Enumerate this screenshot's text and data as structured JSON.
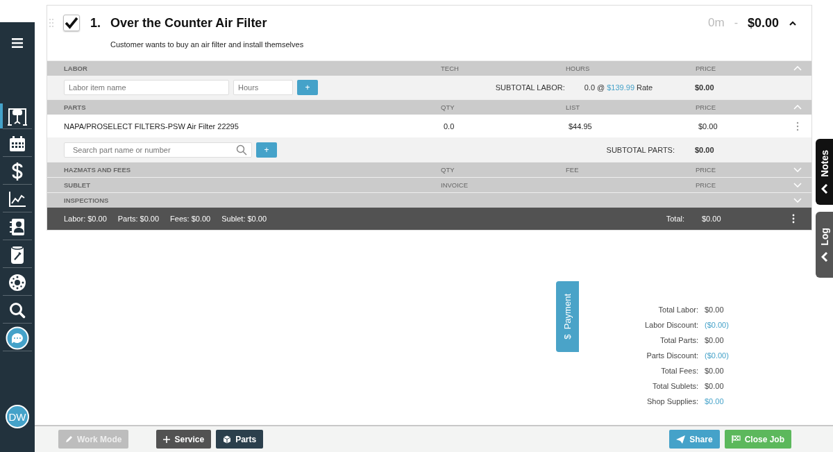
{
  "sidebar": {
    "items": [
      {
        "kind": "menu",
        "selected": false
      },
      {
        "kind": "lift",
        "selected": true
      },
      {
        "kind": "calendar",
        "selected": false
      },
      {
        "kind": "dollar",
        "selected": false
      },
      {
        "kind": "chart",
        "selected": false
      },
      {
        "kind": "contact",
        "selected": false
      },
      {
        "kind": "oil",
        "selected": false
      },
      {
        "kind": "wheel",
        "selected": false
      },
      {
        "kind": "search",
        "selected": false
      },
      {
        "kind": "chat",
        "selected": false
      }
    ],
    "avatar": "DW"
  },
  "job": {
    "checked": true,
    "number": "1.",
    "title": "Over the Counter Air Filter",
    "description": "Customer wants to buy an air filter and install themselves",
    "duration": "0m",
    "separator": "-",
    "price": "$0.00",
    "expanded": true
  },
  "labor": {
    "title": "LABOR",
    "column_1": "TECH",
    "column_2": "HOURS",
    "column_3": "PRICE",
    "expanded": true,
    "name_placeholder": "Labor item name",
    "hours_placeholder": "Hours",
    "add": "+",
    "subtotal_label": "SUBTOTAL LABOR:",
    "subtotal_hours": "0.0 @",
    "rate": "$139.99",
    "rate_suffix": "Rate",
    "subtotal": "$0.00"
  },
  "parts": {
    "title": "PARTS",
    "column_1": "QTY",
    "column_2": "LIST",
    "column_3": "PRICE",
    "expanded": true,
    "rows": [
      {
        "name": "NAPA/PROSELECT FILTERS-PSW Air Filter 22295",
        "qty": "0.0",
        "list": "$44.95",
        "price": "$0.00"
      }
    ],
    "search_placeholder": "Search part name or number",
    "add": "+",
    "subtotal_label": "SUBTOTAL PARTS:",
    "subtotal": "$0.00"
  },
  "sections": [
    {
      "title": "HAZMATS AND FEES",
      "column_1": "QTY",
      "column_2": "FEE",
      "column_3": "PRICE",
      "expanded": false
    },
    {
      "title": "SUBLET",
      "column_1": "INVOICE",
      "column_3": "PRICE",
      "expanded": false
    },
    {
      "title": "INSPECTIONS",
      "expanded": false
    }
  ],
  "summary": {
    "items": [
      "Labor: $0.00",
      "Parts: $0.00",
      "Fees: $0.00",
      "Sublet: $0.00"
    ],
    "total_label": "Total:",
    "total": "$0.00"
  },
  "payment_tab": {
    "icon": "$",
    "label": "Payment"
  },
  "totals": [
    {
      "label": "Total Labor:",
      "value": "$0.00",
      "link": false
    },
    {
      "label": "Labor Discount:",
      "value": "($0.00)",
      "link": true
    },
    {
      "label": "Total Parts:",
      "value": "$0.00",
      "link": false
    },
    {
      "label": "Parts Discount:",
      "value": "($0.00)",
      "link": true
    },
    {
      "label": "Total Fees:",
      "value": "$0.00",
      "link": false
    },
    {
      "label": "Total Sublets:",
      "value": "$0.00",
      "link": false
    },
    {
      "label": "Shop Supplies:",
      "value": "$0.00",
      "link": true
    }
  ],
  "side_tabs": [
    {
      "label": "Notes",
      "kind": "notes"
    },
    {
      "label": "Log",
      "kind": "log"
    }
  ],
  "bottom_bar": {
    "left_buttons": [
      {
        "kind": "work_mode",
        "label": "Work Mode",
        "disabled": true
      },
      {
        "kind": "service",
        "label": "Service",
        "disabled": false
      },
      {
        "kind": "parts",
        "label": "Parts",
        "disabled": false
      }
    ],
    "right_buttons": [
      {
        "kind": "share",
        "label": "Share",
        "disabled": false
      },
      {
        "kind": "close_job",
        "label": "Close Job",
        "disabled": false
      }
    ]
  }
}
